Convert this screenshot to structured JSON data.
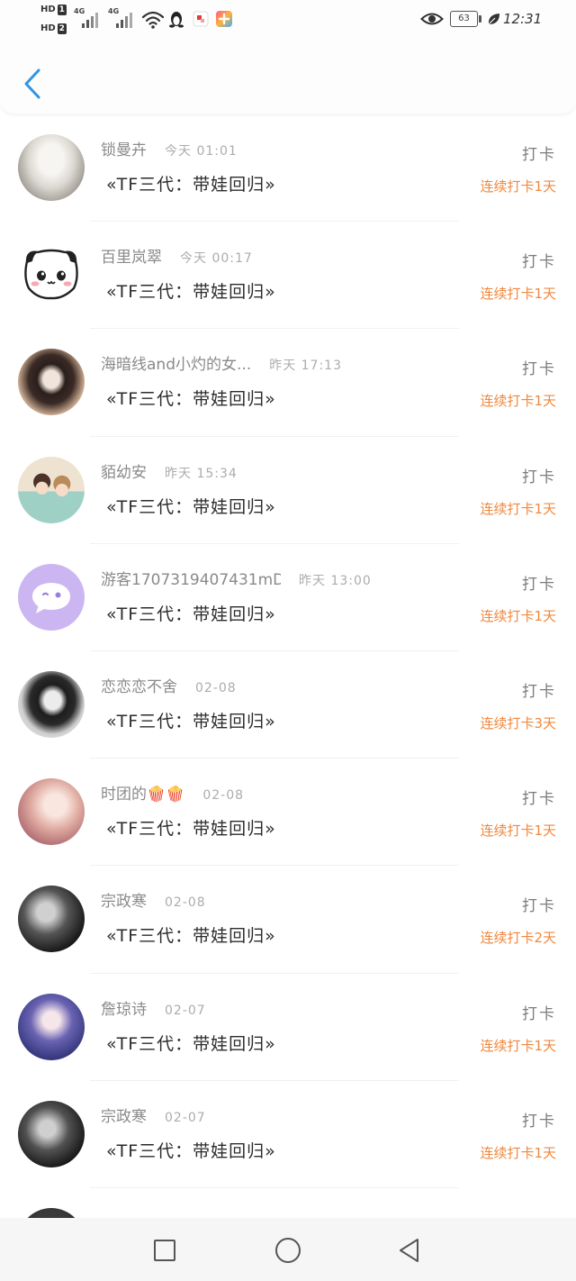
{
  "theme": {
    "accent": "#2f95e6",
    "streak": "#f0883e"
  },
  "status_bar": {
    "hd1": "HD",
    "sim1": "1",
    "hd2": "HD",
    "sim2": "2",
    "net1": "4G",
    "net2": "4G",
    "battery": "63",
    "time": "12:31",
    "icons": [
      "signal-icon",
      "signal-icon",
      "wifi-icon",
      "qq-icon",
      "app-notification-icon",
      "app-icon",
      "eye-icon",
      "battery-icon",
      "leaf-icon"
    ]
  },
  "header": {
    "back_icon": "chevron-left-icon"
  },
  "checkins": [
    {
      "name": "锁曼卉",
      "time": "今天 01:01",
      "title": "«TF三代：带娃回归»",
      "action": "打卡",
      "streak": "连续打卡1天"
    },
    {
      "name": "百里岚翠",
      "time": "今天 00:17",
      "title": "«TF三代：带娃回归»",
      "action": "打卡",
      "streak": "连续打卡1天"
    },
    {
      "name": "海暗线and小灼的女...",
      "time": "昨天 17:13",
      "title": "«TF三代：带娃回归»",
      "action": "打卡",
      "streak": "连续打卡1天"
    },
    {
      "name": "貊幼安",
      "time": "昨天 15:34",
      "title": "«TF三代：带娃回归»",
      "action": "打卡",
      "streak": "连续打卡1天"
    },
    {
      "name": "游客1707319407431mD...",
      "time": "昨天 13:00",
      "title": "«TF三代：带娃回归»",
      "action": "打卡",
      "streak": "连续打卡1天"
    },
    {
      "name": "恋恋恋不舍",
      "time": "02-08",
      "title": "«TF三代：带娃回归»",
      "action": "打卡",
      "streak": "连续打卡3天"
    },
    {
      "name": "时团的🍿🍿",
      "time": "02-08",
      "title": "«TF三代：带娃回归»",
      "action": "打卡",
      "streak": "连续打卡1天"
    },
    {
      "name": "宗政寒",
      "time": "02-08",
      "title": "«TF三代：带娃回归»",
      "action": "打卡",
      "streak": "连续打卡2天"
    },
    {
      "name": "詹琼诗",
      "time": "02-07",
      "title": "«TF三代：带娃回归»",
      "action": "打卡",
      "streak": "连续打卡1天"
    },
    {
      "name": "宗政寒",
      "time": "02-07",
      "title": "«TF三代：带娃回归»",
      "action": "打卡",
      "streak": "连续打卡1天"
    }
  ],
  "nav_bar": {
    "icons": [
      "square-icon",
      "circle-icon",
      "triangle-back-icon"
    ]
  }
}
